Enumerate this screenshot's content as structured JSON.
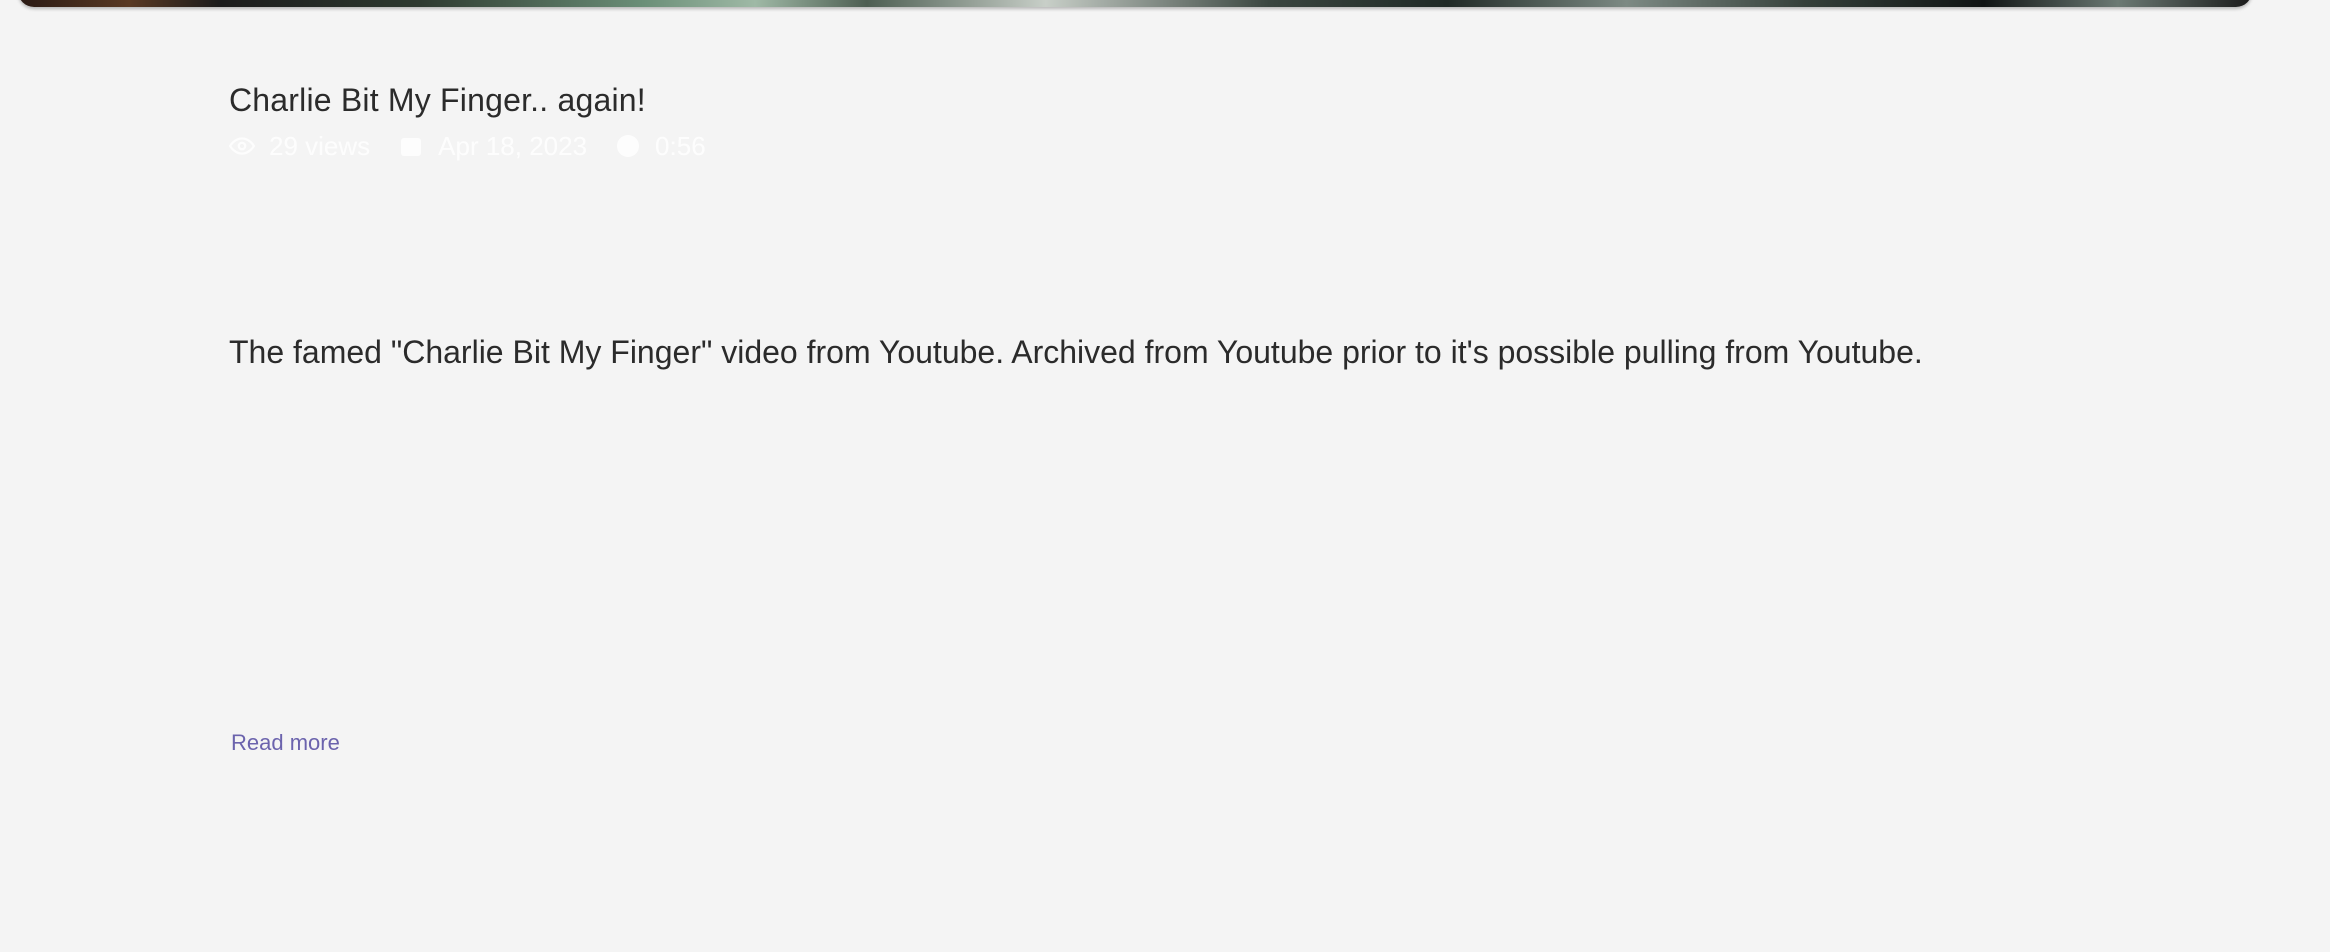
{
  "video": {
    "title": "Charlie Bit My Finger.. again!",
    "meta": {
      "views": "29 views",
      "date": "Apr 18, 2023",
      "duration": "0:56"
    },
    "description": "The famed \"Charlie Bit My Finger\" video from Youtube. Archived from Youtube prior to it's possible pulling from Youtube.",
    "read_more_label": "Read more"
  },
  "icons": {
    "views": "eye-icon",
    "date": "calendar-icon",
    "duration": "clock-icon"
  },
  "colors": {
    "background": "#f4f4f4",
    "text": "#2b2b2b",
    "link": "#6b63ad",
    "meta_text": "#ffffff"
  }
}
